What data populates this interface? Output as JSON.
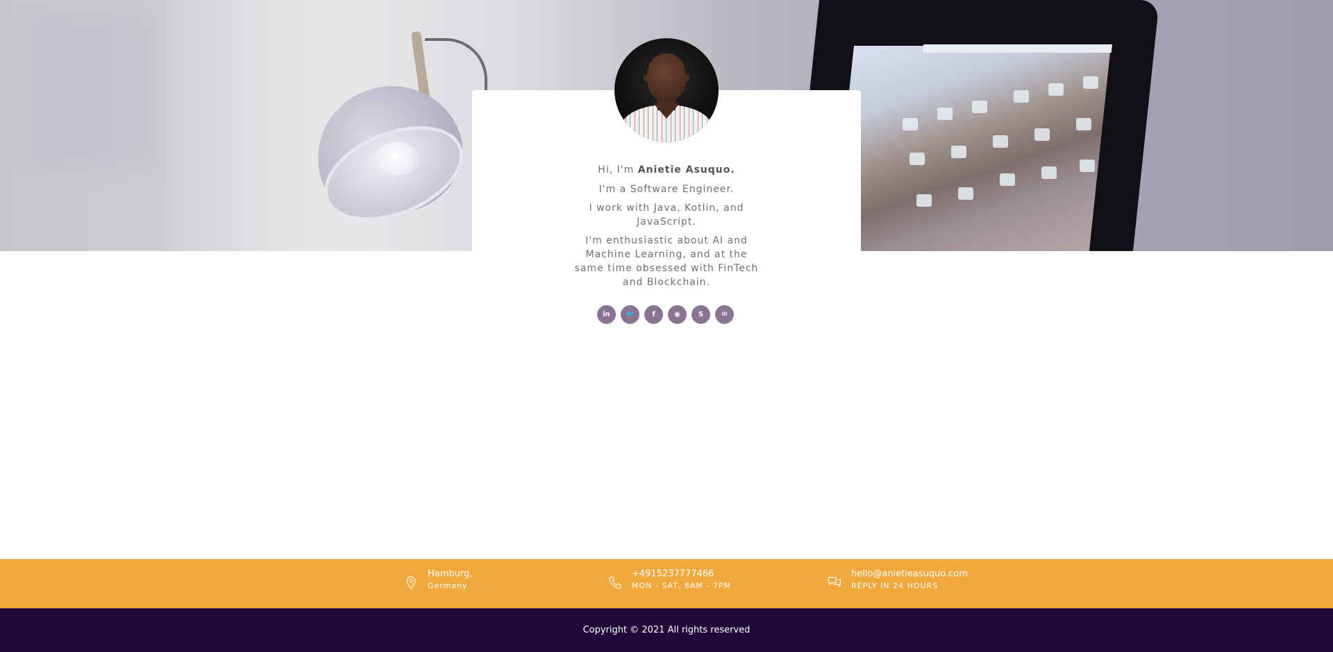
{
  "profile": {
    "greeting_prefix": "Hi, I'm",
    "name": "Anietie Asuquo.",
    "role": "I'm a Software Engineer.",
    "languages": "I work with Java, Kotlin, and JavaScript.",
    "interests": "I'm enthusiastic about AI and Machine Learning, and at the same time obsessed with FinTech and Blockchain."
  },
  "socials": [
    {
      "icon": "linkedin-icon",
      "glyph": "in"
    },
    {
      "icon": "twitter-icon",
      "glyph": "🐦"
    },
    {
      "icon": "facebook-icon",
      "glyph": "f"
    },
    {
      "icon": "github-icon",
      "glyph": "◉"
    },
    {
      "icon": "skype-icon",
      "glyph": "S"
    },
    {
      "icon": "mail-icon",
      "glyph": "✉"
    }
  ],
  "contact": {
    "location": {
      "icon": "map-pin-icon",
      "line1": "Hamburg,",
      "line2": "Germany"
    },
    "phone": {
      "icon": "phone-icon",
      "line1": "+4915237777466",
      "line2": "MON - SAT, 8AM - 7PM"
    },
    "email": {
      "icon": "chat-bubbles-icon",
      "line1": "hello@anietieasuquo.com",
      "line2": "REPLY IN 24 HOURS"
    }
  },
  "footer": {
    "copyright": "Copyright © 2021 All rights reserved"
  },
  "colors": {
    "social_bg": "#8a7494",
    "contact_bar": "#f0a73c",
    "footer_bg": "#22073a"
  }
}
